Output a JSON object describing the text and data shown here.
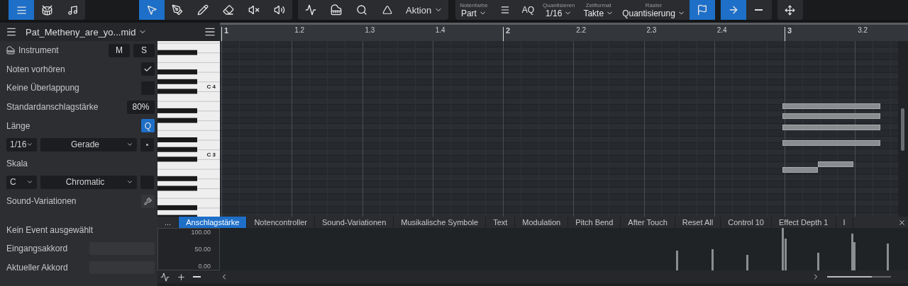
{
  "toolbar": {
    "views": [
      {
        "selected": true
      },
      {
        "selected": false
      },
      {
        "selected": false
      }
    ],
    "tools": [
      {
        "selected": true
      },
      {
        "selected": false
      },
      {
        "selected": false
      },
      {
        "selected": false
      },
      {
        "selected": false
      },
      {
        "selected": false
      }
    ],
    "zoom": {
      "level": 0.7
    },
    "actions_label": "Aktion",
    "fields": [
      {
        "label": "Notenfarbe",
        "value": "Part"
      },
      {
        "label": "Quantisieren",
        "value": "1/16"
      },
      {
        "label": "Zeitformat",
        "value": "Takte"
      },
      {
        "label": "Raster",
        "value": "Quantisierung"
      }
    ],
    "aq": "AQ"
  },
  "header": {
    "file": "Pat_Metheny_are_yo...mid"
  },
  "ruler": [
    "1",
    "1.2",
    "1.3",
    "1.4",
    "2",
    "2.2",
    "2.3",
    "2.4",
    "3",
    "3.2"
  ],
  "inspector": {
    "instrument": "Instrument",
    "mute": "M",
    "solo": "S",
    "preview": {
      "label": "Noten vorhören",
      "checked": true
    },
    "overlap": {
      "label": "Keine Überlappung",
      "checked": false
    },
    "velocity": {
      "label": "Standardanschlagstärke",
      "value": "80%"
    },
    "length": {
      "label": "Länge",
      "button": "Q",
      "on": true
    },
    "length_value": "1/16",
    "length_type": "Gerade",
    "scale": {
      "label": "Skala",
      "root": "C",
      "type": "Chromatic"
    },
    "sound_variations": "Sound-Variationen",
    "event": "Kein Event ausgewählt",
    "chords": [
      {
        "label": "Eingangsakkord"
      },
      {
        "label": "Aktueller Akkord"
      }
    ]
  },
  "piano": {
    "labels": [
      "C 4",
      "C 3"
    ]
  },
  "lanes": {
    "more": "...",
    "tabs": [
      {
        "label": "Anschlagstärke",
        "selected": true
      },
      {
        "label": "Notencontroller",
        "selected": false
      },
      {
        "label": "Sound-Variationen",
        "selected": false
      },
      {
        "label": "Musikalische Symbole",
        "selected": false
      },
      {
        "label": "Text",
        "selected": false
      },
      {
        "label": "Modulation",
        "selected": false
      },
      {
        "label": "Pitch Bend",
        "selected": false
      },
      {
        "label": "After Touch",
        "selected": false
      },
      {
        "label": "Reset All",
        "selected": false
      },
      {
        "label": "Control 10",
        "selected": false
      },
      {
        "label": "Effect Depth 1",
        "selected": false
      },
      {
        "label": "I",
        "selected": false
      }
    ],
    "scale": [
      "100.00",
      "50.00",
      "0.00"
    ]
  }
}
